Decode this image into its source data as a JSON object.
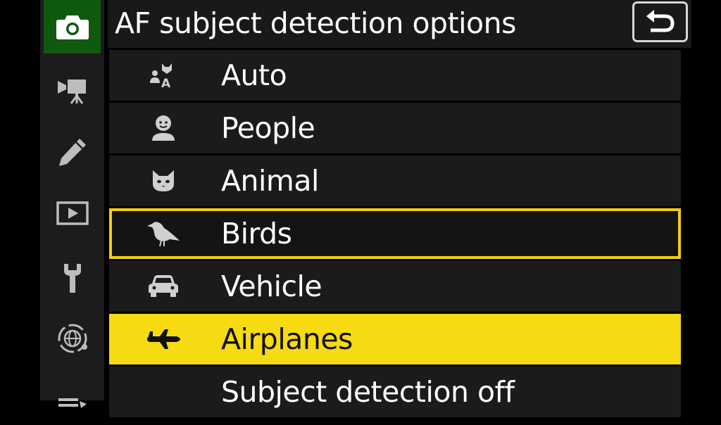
{
  "header": {
    "title": "AF subject detection options",
    "back_icon": "return-arrow-icon"
  },
  "rail": {
    "tabs": [
      {
        "icon": "camera-icon",
        "active": true
      },
      {
        "icon": "movie-camera-icon",
        "active": false
      },
      {
        "icon": "pencil-icon",
        "active": false
      },
      {
        "icon": "playback-icon",
        "active": false
      },
      {
        "icon": "wrench-icon",
        "active": false
      },
      {
        "icon": "network-icon",
        "active": false
      },
      {
        "icon": "my-menu-icon",
        "active": false
      }
    ]
  },
  "menu": {
    "items": [
      {
        "label": "Auto",
        "icon": "auto-subject-icon",
        "state": "normal"
      },
      {
        "label": "People",
        "icon": "person-icon",
        "state": "normal"
      },
      {
        "label": "Animal",
        "icon": "cat-icon",
        "state": "normal"
      },
      {
        "label": "Birds",
        "icon": "bird-icon",
        "state": "highlighted"
      },
      {
        "label": "Vehicle",
        "icon": "car-icon",
        "state": "normal"
      },
      {
        "label": "Airplanes",
        "icon": "airplane-icon",
        "state": "selected"
      },
      {
        "label": "Subject detection off",
        "icon": "",
        "state": "normal"
      }
    ]
  },
  "colors": {
    "accent_yellow": "#f6da12",
    "active_tab_green": "#0f5a0f",
    "background": "#000000"
  }
}
